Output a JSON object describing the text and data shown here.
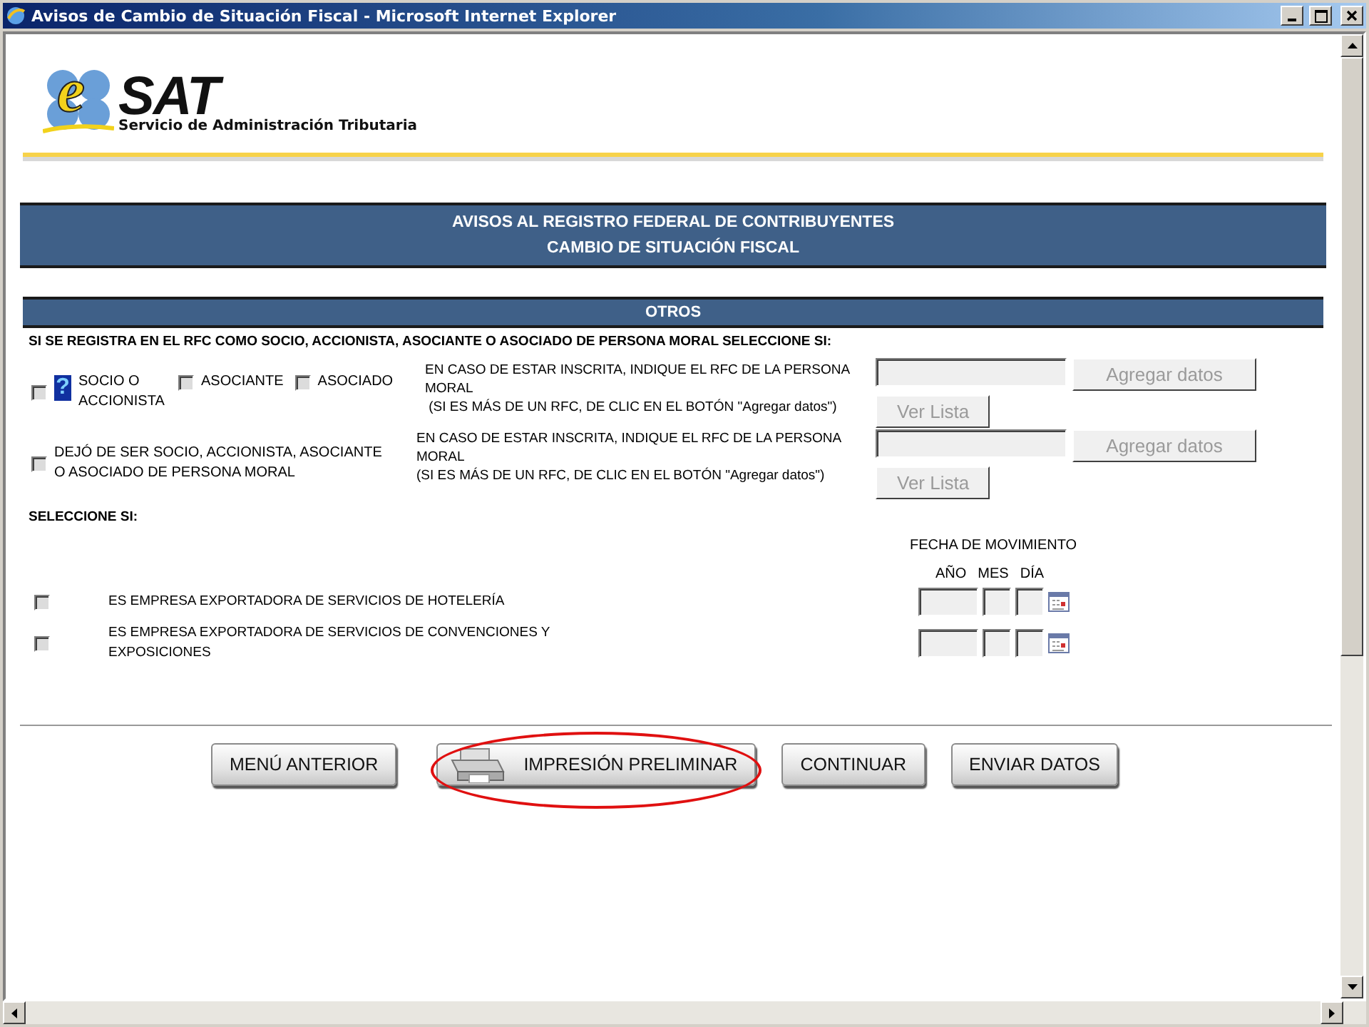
{
  "window": {
    "title": "Avisos de Cambio de Situación Fiscal - Microsoft Internet Explorer"
  },
  "logo": {
    "letter": "e",
    "word": "SAT",
    "subtitle": "Servicio de Administración Tributaria"
  },
  "header": {
    "lines": [
      "AVISOS AL REGISTRO FEDERAL DE CONTRIBUYENTES",
      "CAMBIO DE SITUACIÓN FISCAL"
    ]
  },
  "section_title": "OTROS",
  "intro": "SI SE REGISTRA EN EL RFC COMO SOCIO, ACCIONISTA, ASOCIANTE O ASOCIADO DE PERSONA MORAL SELECCIONE SI:",
  "rows": [
    {
      "options": [
        {
          "label": "SOCIO O ACCIONISTA",
          "checked": false,
          "disabled": true,
          "help": "?"
        },
        {
          "label": "ASOCIANTE",
          "checked": false,
          "disabled": true
        },
        {
          "label": "ASOCIADO",
          "checked": false,
          "disabled": true
        }
      ],
      "note_lines": [
        "EN CASO DE ESTAR INSCRITA, INDIQUE EL RFC DE LA PERSONA",
        "MORAL",
        " (SI ES MÁS DE UN RFC, DE CLIC EN EL BOTÓN \"Agregar datos\")"
      ],
      "add_button": {
        "label": "Agregar datos",
        "disabled": true
      },
      "list_button": {
        "label": "Ver Lista",
        "disabled": true
      }
    },
    {
      "options": [
        {
          "label": "DEJÓ DE SER SOCIO, ACCIONISTA, ASOCIANTE O ASOCIADO DE PERSONA MORAL",
          "checked": false,
          "disabled": true
        }
      ],
      "note_lines": [
        "EN CASO DE ESTAR INSCRITA, INDIQUE EL RFC DE LA PERSONA",
        "MORAL",
        "(SI ES MÁS DE UN RFC, DE CLIC EN EL BOTÓN \"Agregar datos\")"
      ],
      "add_button": {
        "label": "Agregar datos",
        "disabled": true
      },
      "list_button": {
        "label": "Ver Lista",
        "disabled": true
      }
    }
  ],
  "select_label": "SELECCIONE SI:",
  "date_header": "FECHA DE MOVIMIENTO",
  "date_columns": [
    "AÑO",
    "MES",
    "DÍA"
  ],
  "exports": [
    {
      "label": "ES EMPRESA EXPORTADORA DE SERVICIOS DE HOTELERÍA",
      "checked": false,
      "disabled": true
    },
    {
      "label": "ES EMPRESA EXPORTADORA DE SERVICIOS DE CONVENCIONES Y EXPOSICIONES",
      "checked": false,
      "disabled": true
    }
  ],
  "buttons": [
    {
      "label": "MENÚ ANTERIOR",
      "kind": "plain",
      "highlighted": false
    },
    {
      "label": "IMPRESIÓN PRELIMINAR",
      "kind": "printer",
      "highlighted": true
    },
    {
      "label": "CONTINUAR",
      "kind": "plain",
      "highlighted": false
    },
    {
      "label": "ENVIAR DATOS",
      "kind": "plain",
      "highlighted": false
    }
  ]
}
